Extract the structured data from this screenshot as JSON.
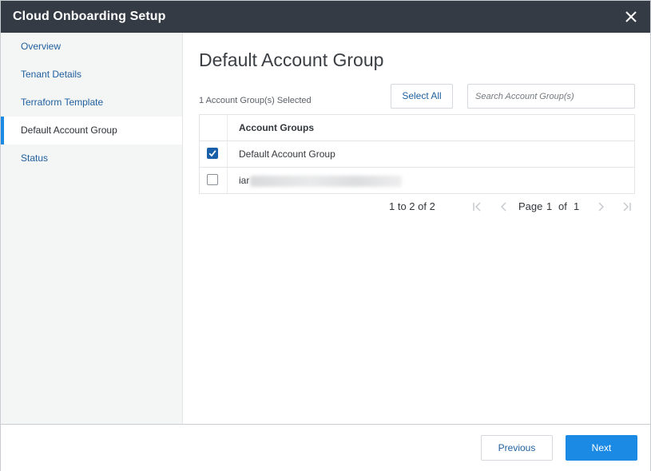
{
  "window": {
    "title": "Cloud Onboarding Setup"
  },
  "sidebar": {
    "items": [
      {
        "label": "Overview",
        "active": false
      },
      {
        "label": "Tenant Details",
        "active": false
      },
      {
        "label": "Terraform Template",
        "active": false
      },
      {
        "label": "Default Account Group",
        "active": true
      },
      {
        "label": "Status",
        "active": false
      }
    ]
  },
  "main": {
    "heading": "Default Account Group",
    "selected_count": "1 Account Group(s) Selected",
    "select_all_label": "Select All",
    "search": {
      "placeholder": "Search Account Group(s)",
      "value": ""
    },
    "table": {
      "column_header": "Account Groups",
      "rows": [
        {
          "name": "Default Account Group",
          "checked": true
        },
        {
          "name": "iar",
          "checked": false,
          "redacted": true
        }
      ]
    },
    "pagination": {
      "range": "1 to 2 of 2",
      "page_label": "Page",
      "current_page": "1",
      "of_label": "of",
      "total_pages": "1"
    }
  },
  "footer": {
    "previous_label": "Previous",
    "next_label": "Next"
  },
  "colors": {
    "titlebar": "#353b45",
    "accent": "#1a8ae5",
    "checkbox_checked": "#1a60a8",
    "link": "#1f5f9e"
  },
  "icons": {
    "close": "close-icon",
    "checkbox": "checkmark-icon",
    "pager": [
      "first-page-icon",
      "prev-page-icon",
      "next-page-icon",
      "last-page-icon"
    ]
  }
}
